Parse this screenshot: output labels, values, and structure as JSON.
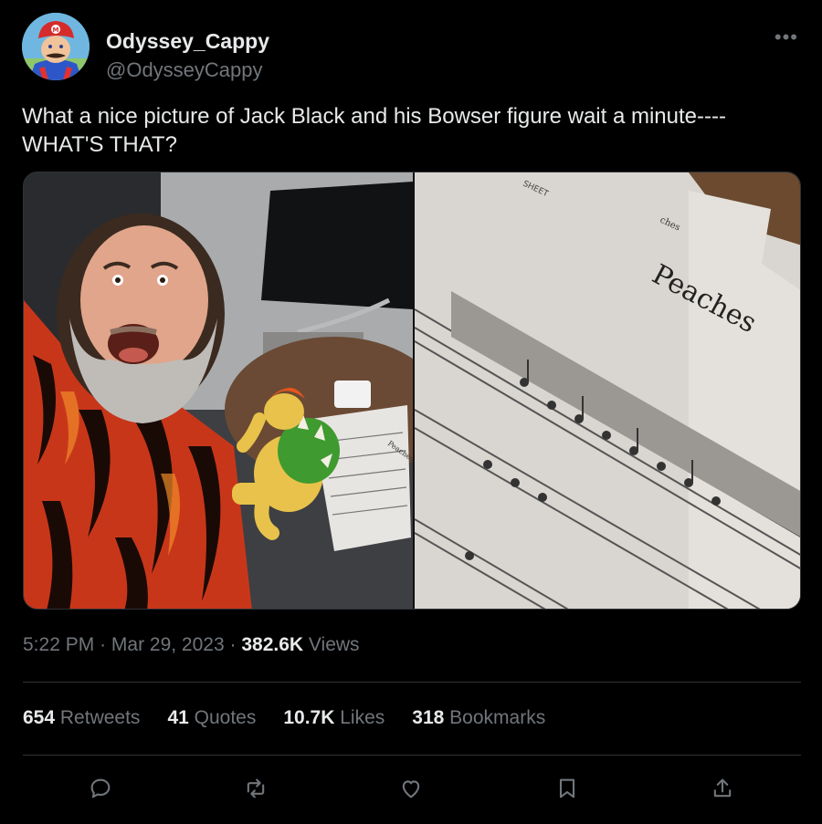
{
  "author": {
    "display_name": "Odyssey_Cappy",
    "handle": "@OdysseyCappy",
    "avatar_icon": "mario-avatar"
  },
  "tweet": {
    "text_line1": "What a nice picture of Jack Black and his Bowser figure wait a minute----",
    "text_line2": "WHAT'S THAT?"
  },
  "media": {
    "right_sheet_title": "Peaches",
    "right_sheet_corner": "SHEET",
    "right_sheet_small": "ches",
    "left_sheet_label": "Peaches"
  },
  "meta": {
    "time": "5:22 PM",
    "sep1": "·",
    "date": "Mar 29, 2023",
    "sep2": "·",
    "views_count": "382.6K",
    "views_label": "Views"
  },
  "stats": {
    "retweets_count": "654",
    "retweets_label": "Retweets",
    "quotes_count": "41",
    "quotes_label": "Quotes",
    "likes_count": "10.7K",
    "likes_label": "Likes",
    "bookmarks_count": "318",
    "bookmarks_label": "Bookmarks"
  },
  "actions": [
    "reply-icon",
    "retweet-icon",
    "like-icon",
    "bookmark-icon",
    "share-icon"
  ],
  "colors": {
    "background": "#000000",
    "text_primary": "#e7e9ea",
    "text_secondary": "#71767b",
    "divider": "#2f3336"
  }
}
